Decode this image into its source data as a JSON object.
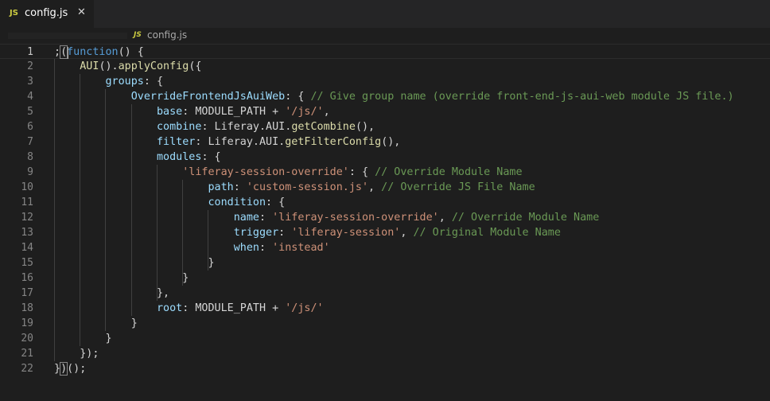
{
  "tab": {
    "badge": "JS",
    "label": "config.js",
    "close": "✕"
  },
  "breadcrumb": {
    "badge": "JS",
    "label": "config.js"
  },
  "colors": {
    "keyword": "#569cd6",
    "function": "#dcdcaa",
    "property": "#9cdcfe",
    "string": "#ce9178",
    "comment": "#6a9955",
    "text": "#d4d4d4"
  },
  "line_numbers": [
    "1",
    "2",
    "3",
    "4",
    "5",
    "6",
    "7",
    "8",
    "9",
    "10",
    "11",
    "12",
    "13",
    "14",
    "15",
    "16",
    "17",
    "18",
    "19",
    "20",
    "21",
    "22"
  ],
  "lines": [
    [
      {
        "t": "pl",
        "v": ";"
      },
      {
        "t": "pl",
        "v": "(",
        "m": 1
      },
      {
        "t": "kw",
        "v": "function"
      },
      {
        "t": "pl",
        "v": "() {"
      }
    ],
    [
      {
        "t": "pl",
        "v": "    "
      },
      {
        "t": "fn",
        "v": "AUI"
      },
      {
        "t": "pl",
        "v": "()."
      },
      {
        "t": "fn",
        "v": "applyConfig"
      },
      {
        "t": "pl",
        "v": "({"
      }
    ],
    [
      {
        "t": "pl",
        "v": "        "
      },
      {
        "t": "prop",
        "v": "groups"
      },
      {
        "t": "pl",
        "v": ": {"
      }
    ],
    [
      {
        "t": "pl",
        "v": "            "
      },
      {
        "t": "prop",
        "v": "OverrideFrontendJsAuiWeb"
      },
      {
        "t": "pl",
        "v": ": { "
      },
      {
        "t": "cmt",
        "v": "// Give group name (override front-end-js-aui-web module JS file.)"
      }
    ],
    [
      {
        "t": "pl",
        "v": "                "
      },
      {
        "t": "prop",
        "v": "base"
      },
      {
        "t": "pl",
        "v": ": MODULE_PATH + "
      },
      {
        "t": "str",
        "v": "'/js/'"
      },
      {
        "t": "pl",
        "v": ","
      }
    ],
    [
      {
        "t": "pl",
        "v": "                "
      },
      {
        "t": "prop",
        "v": "combine"
      },
      {
        "t": "pl",
        "v": ": Liferay.AUI."
      },
      {
        "t": "fn",
        "v": "getCombine"
      },
      {
        "t": "pl",
        "v": "(),"
      }
    ],
    [
      {
        "t": "pl",
        "v": "                "
      },
      {
        "t": "prop",
        "v": "filter"
      },
      {
        "t": "pl",
        "v": ": Liferay.AUI."
      },
      {
        "t": "fn",
        "v": "getFilterConfig"
      },
      {
        "t": "pl",
        "v": "(),"
      }
    ],
    [
      {
        "t": "pl",
        "v": "                "
      },
      {
        "t": "prop",
        "v": "modules"
      },
      {
        "t": "pl",
        "v": ": {"
      }
    ],
    [
      {
        "t": "pl",
        "v": "                    "
      },
      {
        "t": "str",
        "v": "'liferay-session-override'"
      },
      {
        "t": "pl",
        "v": ": { "
      },
      {
        "t": "cmt",
        "v": "// Override Module Name"
      }
    ],
    [
      {
        "t": "pl",
        "v": "                        "
      },
      {
        "t": "prop",
        "v": "path"
      },
      {
        "t": "pl",
        "v": ": "
      },
      {
        "t": "str",
        "v": "'custom-session.js'"
      },
      {
        "t": "pl",
        "v": ", "
      },
      {
        "t": "cmt",
        "v": "// Override JS File Name"
      }
    ],
    [
      {
        "t": "pl",
        "v": "                        "
      },
      {
        "t": "prop",
        "v": "condition"
      },
      {
        "t": "pl",
        "v": ": {"
      }
    ],
    [
      {
        "t": "pl",
        "v": "                            "
      },
      {
        "t": "prop",
        "v": "name"
      },
      {
        "t": "pl",
        "v": ": "
      },
      {
        "t": "str",
        "v": "'liferay-session-override'"
      },
      {
        "t": "pl",
        "v": ", "
      },
      {
        "t": "cmt",
        "v": "// Override Module Name"
      }
    ],
    [
      {
        "t": "pl",
        "v": "                            "
      },
      {
        "t": "prop",
        "v": "trigger"
      },
      {
        "t": "pl",
        "v": ": "
      },
      {
        "t": "str",
        "v": "'liferay-session'"
      },
      {
        "t": "pl",
        "v": ", "
      },
      {
        "t": "cmt",
        "v": "// Original Module Name"
      }
    ],
    [
      {
        "t": "pl",
        "v": "                            "
      },
      {
        "t": "prop",
        "v": "when"
      },
      {
        "t": "pl",
        "v": ": "
      },
      {
        "t": "str",
        "v": "'instead'"
      }
    ],
    [
      {
        "t": "pl",
        "v": "                        }"
      }
    ],
    [
      {
        "t": "pl",
        "v": "                    }"
      }
    ],
    [
      {
        "t": "pl",
        "v": "                },"
      }
    ],
    [
      {
        "t": "pl",
        "v": "                "
      },
      {
        "t": "prop",
        "v": "root"
      },
      {
        "t": "pl",
        "v": ": MODULE_PATH + "
      },
      {
        "t": "str",
        "v": "'/js/'"
      }
    ],
    [
      {
        "t": "pl",
        "v": "            }"
      }
    ],
    [
      {
        "t": "pl",
        "v": "        }"
      }
    ],
    [
      {
        "t": "pl",
        "v": "    });"
      }
    ],
    [
      {
        "t": "pl",
        "v": "}"
      },
      {
        "t": "pl",
        "v": ")",
        "m": 1
      },
      {
        "t": "pl",
        "v": "();"
      }
    ]
  ]
}
